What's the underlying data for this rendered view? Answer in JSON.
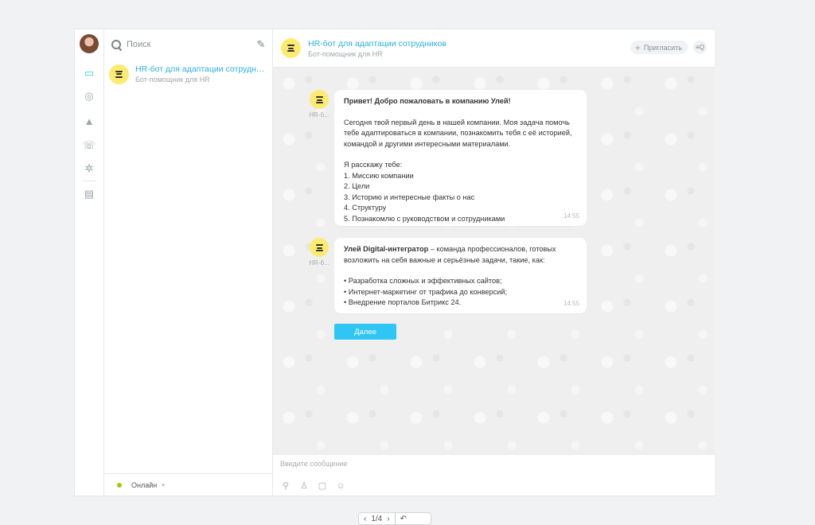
{
  "rail": {
    "items": [
      {
        "name": "chats-icon",
        "glyph": "▭",
        "active": true
      },
      {
        "name": "openlines-icon",
        "glyph": "◎",
        "active": false
      },
      {
        "name": "notifications-icon",
        "glyph": "▲",
        "active": false
      },
      {
        "name": "phone-icon",
        "glyph": "☏",
        "active": false
      },
      {
        "name": "settings-icon",
        "glyph": "✲",
        "active": false
      },
      {
        "name": "history-icon",
        "glyph": "▤",
        "active": false
      }
    ]
  },
  "sidebar": {
    "search_placeholder": "Поиск",
    "compose_glyph": "✎",
    "chats": [
      {
        "title": "HR-бот для адаптации сотрудников",
        "subtitle": "Бот-помощник для HR"
      }
    ],
    "status": "Онлайн",
    "status_caret": "▾"
  },
  "header": {
    "title": "HR-бот для адаптации сотрудников",
    "subtitle": "Бот-помощник для HR",
    "invite_plus": "+",
    "invite_label": "Пригласить",
    "search_glyph": "≡Q"
  },
  "messages": [
    {
      "author": "HR-б...",
      "time": "14:55",
      "heading": "Привет! Добро пожаловать в компанию Улей!",
      "paragraph": "Сегодня твой первый день в нашей компании. Моя задача помочь тебе адаптироваться в компании, познакомить тебя с её историей, командой и другими интересными материалами.",
      "list_intro": "Я расскажу тебе:",
      "list": [
        "1. Миссию компании",
        "2. Цели",
        "3. Историю и интересные факты о нас",
        "4. Структуру",
        "5. Познакомлю с руководством и сотрудниками"
      ]
    },
    {
      "author": "HR-б...",
      "time": "14:55",
      "bold": "Улей Digital-интегратор",
      "text": " – команда профессионалов, готовых возложить на себя важные и серьёзные задачи, такие, как:",
      "bullets": [
        "•  Разработка сложных и эффективных сайтов;",
        "•  Интернет-маркетинг от трафика до конверсий;",
        "•  Внедрение порталов Битрикс 24."
      ]
    }
  ],
  "next_button": "Далее",
  "input": {
    "placeholder": "Введите сообщение",
    "tools": [
      {
        "name": "attach-icon",
        "glyph": "⚲"
      },
      {
        "name": "user-icon",
        "glyph": "♙"
      },
      {
        "name": "template-icon",
        "glyph": "▢"
      },
      {
        "name": "smile-icon",
        "glyph": "☺"
      }
    ]
  },
  "pager": {
    "prev": "‹",
    "label": "1/4",
    "next": "›",
    "undo": "↶"
  }
}
